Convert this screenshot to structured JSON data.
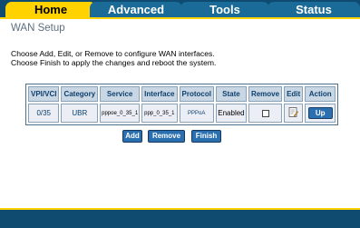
{
  "tabs": [
    {
      "label": "Home",
      "active": true
    },
    {
      "label": "Advanced",
      "active": false
    },
    {
      "label": "Tools",
      "active": false
    },
    {
      "label": "Status",
      "active": false
    }
  ],
  "page": {
    "title": "WAN Setup",
    "description_line1": "Choose Add, Edit, or Remove to configure WAN interfaces.",
    "description_line2": "Choose Finish to apply the changes and reboot the system."
  },
  "table": {
    "headers": [
      "VPI/VCI",
      "Category",
      "Service",
      "Interface",
      "Protocol",
      "State",
      "Remove",
      "Edit",
      "Action"
    ],
    "rows": [
      {
        "vpi_vci": "0/35",
        "category": "UBR",
        "service": "pppoe_0_35_1",
        "interface": "ppp_0_35_1",
        "protocol": "PPPoA",
        "state": "Enabled",
        "remove_checked": false,
        "edit_icon": "edit-icon",
        "action_label": "Up"
      }
    ]
  },
  "buttons": {
    "add": "Add",
    "remove": "Remove",
    "finish": "Finish"
  },
  "colors": {
    "nav_bg": "#0f4a70",
    "active_tab": "#ffd200",
    "inactive_tab": "#1a6b98",
    "button_bg": "#2a6fb0",
    "header_cell": "#c9d7e5"
  }
}
